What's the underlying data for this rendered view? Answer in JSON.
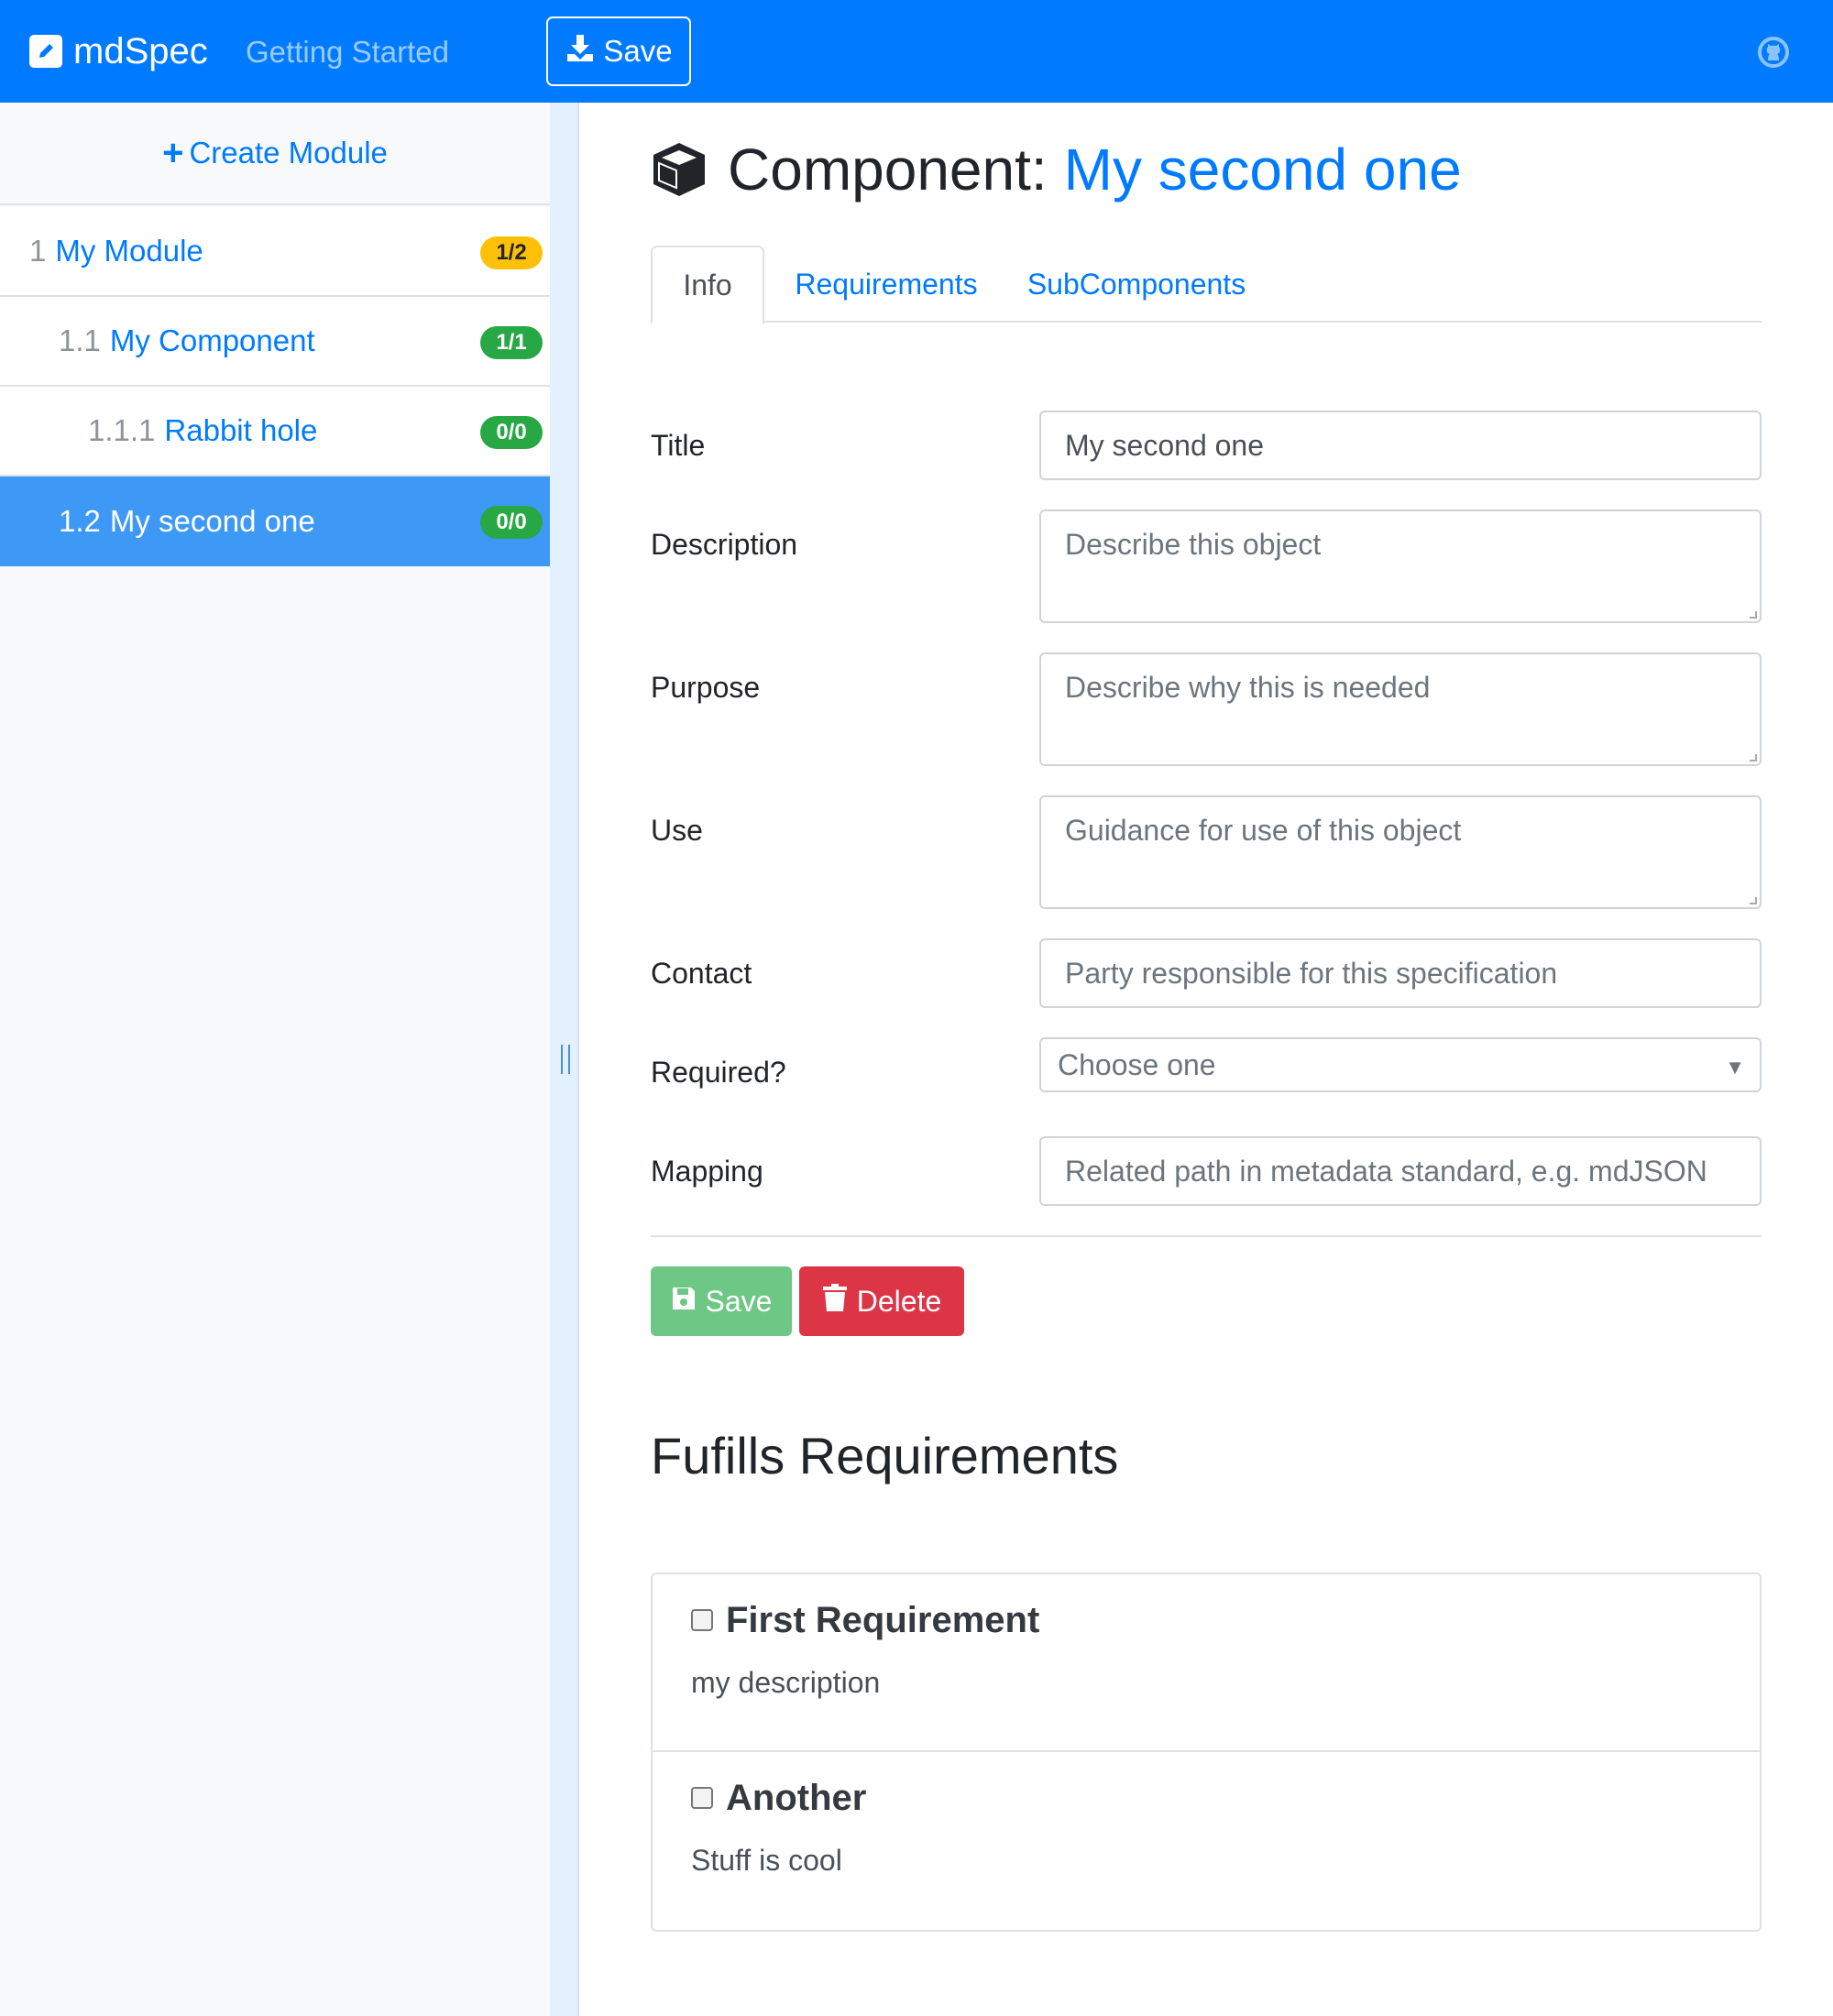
{
  "app": {
    "brand": "mdSpec",
    "nav_link": "Getting Started",
    "save_label": "Save",
    "icons": {
      "brand": "pencil-square-icon",
      "save": "download-icon",
      "github": "github-icon"
    }
  },
  "sidebar": {
    "create_label": "Create Module",
    "items": [
      {
        "num": "1",
        "label": "My Module",
        "badge": "1/2",
        "badge_color": "#ffc107",
        "active": false
      },
      {
        "num": "1.1",
        "label": "My Component",
        "badge": "1/1",
        "badge_color": "#28a745",
        "active": false
      },
      {
        "num": "1.1.1",
        "label": "Rabbit hole",
        "badge": "0/0",
        "badge_color": "#28a745",
        "active": false
      },
      {
        "num": "1.2",
        "label": "My second one",
        "badge": "0/0",
        "badge_color": "#28a745",
        "active": true
      }
    ]
  },
  "main": {
    "heading_prefix": "Component:",
    "heading_name": "My second one",
    "tabs": [
      {
        "label": "Info",
        "active": true
      },
      {
        "label": "Requirements",
        "active": false
      },
      {
        "label": "SubComponents",
        "active": false
      }
    ],
    "form": {
      "title": {
        "label": "Title",
        "value": "My second one"
      },
      "description": {
        "label": "Description",
        "placeholder": "Describe this object"
      },
      "purpose": {
        "label": "Purpose",
        "placeholder": "Describe why this is needed"
      },
      "use": {
        "label": "Use",
        "placeholder": "Guidance for use of this object"
      },
      "contact": {
        "label": "Contact",
        "placeholder": "Party responsible for this specification"
      },
      "required": {
        "label": "Required?",
        "selected": "Choose one"
      },
      "mapping": {
        "label": "Mapping",
        "placeholder": "Related path in metadata standard, e.g. mdJSON"
      }
    },
    "buttons": {
      "save": "Save",
      "delete": "Delete"
    },
    "requirements_heading": "Fufills Requirements",
    "requirements": [
      {
        "title": "First Requirement",
        "description": "my description",
        "checked": false
      },
      {
        "title": "Another",
        "description": "Stuff is cool",
        "checked": false
      }
    ]
  },
  "colors": {
    "primary": "#007bff",
    "success": "#28a745",
    "danger": "#dc3545",
    "warning": "#ffc107"
  }
}
